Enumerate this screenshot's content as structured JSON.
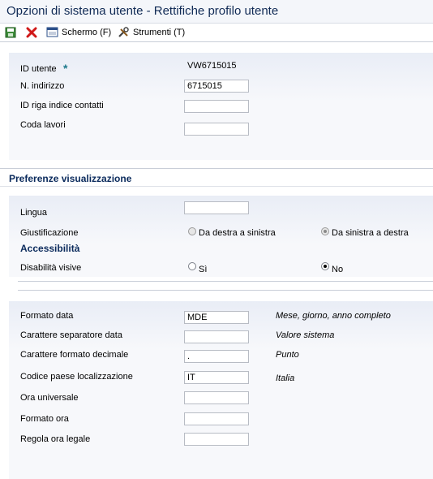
{
  "window": {
    "title": "Opzioni di sistema utente - Rettifiche profilo utente"
  },
  "toolbar": {
    "save_icon": "save-icon",
    "cancel_icon": "cancel-icon",
    "screen_label": "Schermo (F)",
    "tools_label": "Strumenti (T)"
  },
  "user": {
    "id_label": "ID utente",
    "required_mark": "*",
    "id_value": "VW6715015",
    "address_label": "N. indirizzo",
    "address_value": "6715015",
    "contact_label": "ID riga indice contatti",
    "contact_value": "",
    "queue_label": "Coda lavori",
    "queue_value": ""
  },
  "display": {
    "section_title": "Preferenze visualizzazione",
    "language_label": "Lingua",
    "language_value": "",
    "justify_label": "Giustificazione",
    "justify_rtl": "Da destra a sinistra",
    "justify_ltr": "Da sinistra a destra",
    "justify_selected": "Da sinistra a destra",
    "accessibility_title": "Accessibilità",
    "visual_label": "Disabilità visive",
    "visual_yes": "Sì",
    "visual_no": "No",
    "visual_selected": "No"
  },
  "formats": {
    "date_label": "Formato data",
    "date_value": "MDE",
    "date_desc": "Mese, giorno, anno completo",
    "date_sep_label": "Carattere separatore data",
    "date_sep_value": "",
    "date_sep_desc": "Valore sistema",
    "decimal_label": "Carattere formato decimale",
    "decimal_value": ".",
    "decimal_desc": "Punto",
    "country_label": "Codice paese localizzazione",
    "country_value": "IT",
    "country_desc": "Italia",
    "utc_label": "Ora universale",
    "utc_value": "",
    "time_label": "Formato ora",
    "time_value": "",
    "dst_label": "Regola ora legale",
    "dst_value": ""
  }
}
